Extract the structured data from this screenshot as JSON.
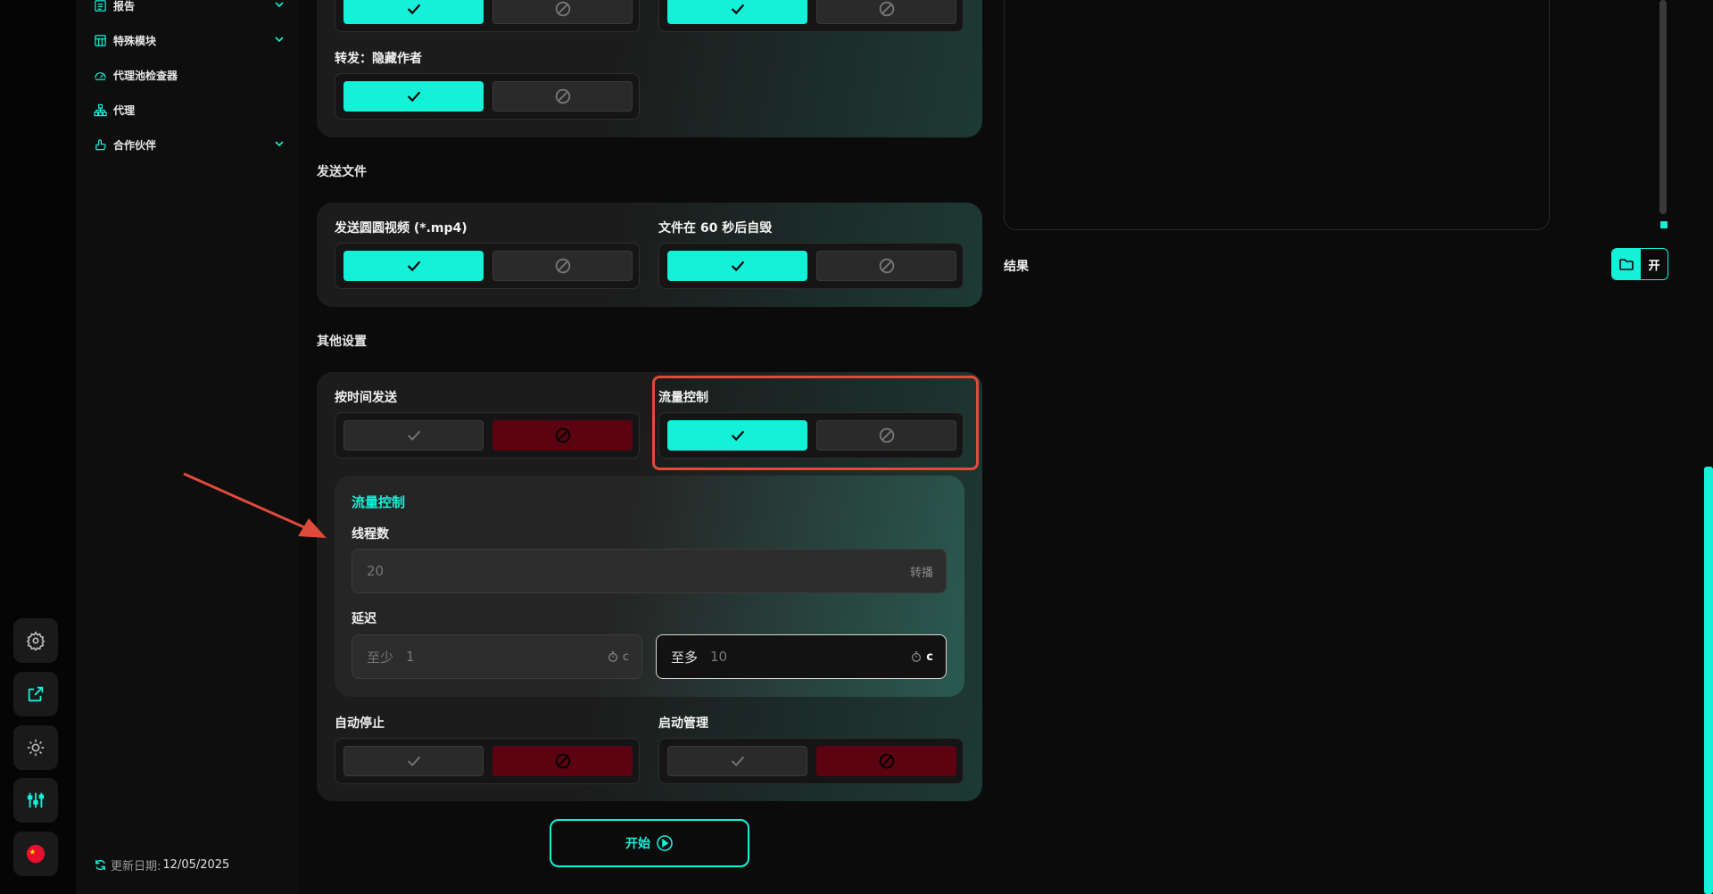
{
  "sidebar": {
    "items": [
      {
        "label": "报告",
        "icon": "report-icon",
        "has_chevron": true
      },
      {
        "label": "特殊模块",
        "icon": "module-icon",
        "has_chevron": true
      },
      {
        "label": "代理池检查器",
        "icon": "checker-icon",
        "has_chevron": false
      },
      {
        "label": "代理",
        "icon": "proxy-icon",
        "has_chevron": false
      },
      {
        "label": "合作伙伴",
        "icon": "partner-icon",
        "has_chevron": true
      }
    ],
    "update_label": "更新日期:",
    "update_date": "12/05/2025"
  },
  "rail": {
    "buttons": [
      "gear-icon",
      "external-link-icon",
      "sun-icon",
      "sliders-icon",
      "china-flag-icon"
    ]
  },
  "sections": {
    "forward": {
      "hide_author_label": "转发：隐藏作者"
    },
    "send_files": {
      "title": "发送文件",
      "round_video_label": "发送圆圆视频 (*.mp4)",
      "self_destruct_label": "文件在 60 秒后自毁"
    },
    "other": {
      "title": "其他设置",
      "schedule_label": "按时间发送",
      "flow_label": "流量控制"
    },
    "flow_control": {
      "title": "流量控制",
      "threads_label": "线程数",
      "threads_value": "20",
      "threads_suffix": "转播",
      "delay_label": "延迟",
      "delay_min_prefix": "至少",
      "delay_min_value": "1",
      "delay_max_prefix": "至多",
      "delay_max_value": "10",
      "unit": "c"
    },
    "bottom": {
      "auto_stop_label": "自动停止",
      "start_manage_label": "启动管理"
    }
  },
  "start_button": "开始",
  "result": {
    "label": "结果",
    "open_label": "开"
  },
  "colors": {
    "accent": "#14f1d9",
    "danger": "#5c0311",
    "highlight": "#e04a3a"
  }
}
